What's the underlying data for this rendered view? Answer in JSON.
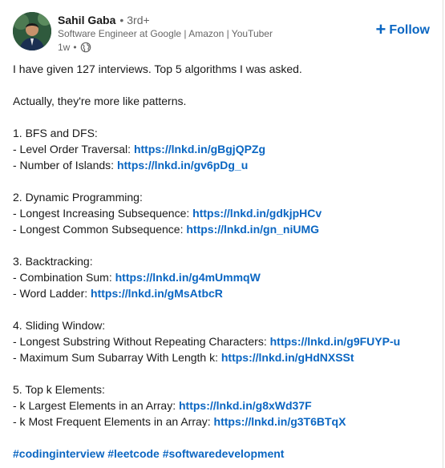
{
  "author": {
    "name": "Sahil Gaba",
    "separator": "•",
    "degree": "3rd+",
    "headline": "Software Engineer at Google | Amazon | YouTuber",
    "time": "1w",
    "time_separator": "•",
    "visibility_icon": "globe-icon"
  },
  "follow": {
    "plus": "+",
    "label": "Follow"
  },
  "post": {
    "intro": "I have given 127 interviews. Top 5 algorithms I was asked.",
    "patterns_line": "Actually, they're more like patterns.",
    "sections": [
      {
        "heading": "1. BFS and DFS:",
        "items": [
          {
            "label": "- Level Order Traversal: ",
            "link": "https://lnkd.in/gBgjQPZg"
          },
          {
            "label": "- Number of Islands: ",
            "link": "https://lnkd.in/gv6pDg_u"
          }
        ]
      },
      {
        "heading": "2. Dynamic Programming:",
        "items": [
          {
            "label": "- Longest Increasing Subsequence: ",
            "link": "https://lnkd.in/gdkjpHCv"
          },
          {
            "label": "- Longest Common Subsequence: ",
            "link": "https://lnkd.in/gn_niUMG"
          }
        ]
      },
      {
        "heading": "3. Backtracking:",
        "items": [
          {
            "label": "- Combination Sum: ",
            "link": "https://lnkd.in/g4mUmmqW"
          },
          {
            "label": "- Word Ladder: ",
            "link": "https://lnkd.in/gMsAtbcR"
          }
        ]
      },
      {
        "heading": "4. Sliding Window:",
        "items": [
          {
            "label": "- Longest Substring Without Repeating Characters: ",
            "link": "https://lnkd.in/g9FUYP-u"
          },
          {
            "label": "- Maximum Sum Subarray With Length k: ",
            "link": "https://lnkd.in/gHdNXSSt"
          }
        ]
      },
      {
        "heading": "5. Top k Elements:",
        "items": [
          {
            "label": "- k Largest Elements in an Array: ",
            "link": "https://lnkd.in/g8xWd37F"
          },
          {
            "label": "- k Most Frequent Elements in an Array: ",
            "link": "https://lnkd.in/g3T6BTqX"
          }
        ]
      }
    ],
    "hashtags": [
      "#codinginterview",
      "#leetcode",
      "#softwaredevelopment"
    ]
  },
  "colors": {
    "link": "#0a66c2",
    "text": "#191919",
    "muted": "#666666"
  }
}
